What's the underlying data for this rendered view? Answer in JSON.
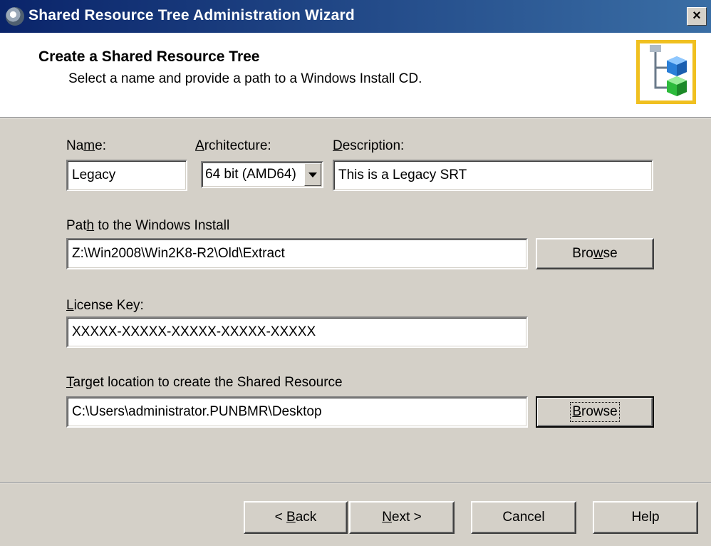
{
  "window": {
    "title": "Shared Resource Tree Administration Wizard",
    "close_label": "×"
  },
  "header": {
    "title": "Create a Shared Resource Tree",
    "subtitle": "Select a name and provide a path to a Windows Install CD."
  },
  "form": {
    "name": {
      "label_pre": "Na",
      "label_key": "m",
      "label_post": "e:",
      "value": "Legacy"
    },
    "architecture": {
      "label_pre": "",
      "label_key": "A",
      "label_post": "rchitecture:",
      "selected": "64 bit (AMD64)"
    },
    "description": {
      "label_pre": "",
      "label_key": "D",
      "label_post": "escription:",
      "value": "This is a Legacy SRT"
    },
    "install_path": {
      "label_pre": "Pat",
      "label_key": "h",
      "label_post": " to the Windows Install",
      "value": "Z:\\Win2008\\Win2K8-R2\\Old\\Extract",
      "browse_pre": "Bro",
      "browse_key": "w",
      "browse_post": "se"
    },
    "license_key": {
      "label_pre": "",
      "label_key": "L",
      "label_post": "icense Key:",
      "value": "XXXXX-XXXXX-XXXXX-XXXXX-XXXXX"
    },
    "target": {
      "label_pre": "",
      "label_key": "T",
      "label_post": "arget location to create the Shared Resource",
      "value": "C:\\Users\\administrator.PUNBMR\\Desktop",
      "browse_pre": "",
      "browse_key": "B",
      "browse_post": "rowse"
    }
  },
  "buttons": {
    "back_pre": "< ",
    "back_key": "B",
    "back_post": "ack",
    "next_pre": "",
    "next_key": "N",
    "next_post": "ext >",
    "cancel": "Cancel",
    "help": "Help"
  }
}
